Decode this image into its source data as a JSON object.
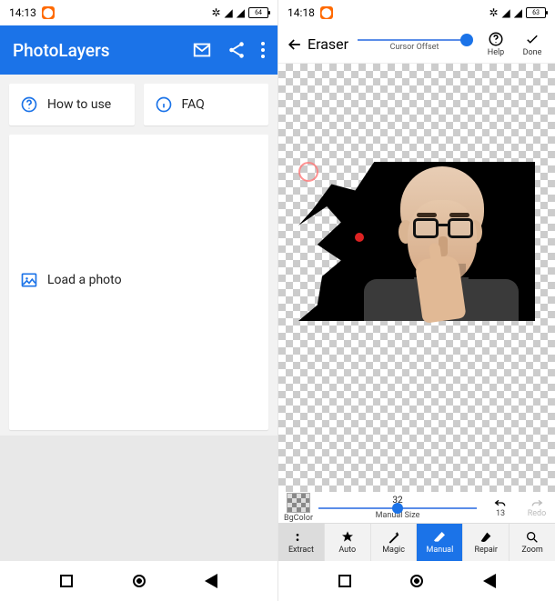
{
  "left": {
    "status": {
      "time": "14:13",
      "battery": "64"
    },
    "appbar": {
      "title": "PhotoLayers"
    },
    "cards": {
      "howto": "How to use",
      "faq": "FAQ",
      "load": "Load a photo"
    }
  },
  "right": {
    "status": {
      "time": "14:18",
      "battery": "63"
    },
    "top": {
      "title": "Eraser",
      "cursor_offset_label": "Cursor Offset",
      "help": "Help",
      "done": "Done"
    },
    "sizebar": {
      "bgcolor": "BgColor",
      "manual_size_val": "32",
      "manual_size_label": "Manual Size",
      "undo_count": "13",
      "redo": "Redo"
    },
    "tabs": {
      "extract": "Extract",
      "auto": "Auto",
      "magic": "Magic",
      "manual": "Manual",
      "repair": "Repair",
      "zoom": "Zoom"
    }
  }
}
